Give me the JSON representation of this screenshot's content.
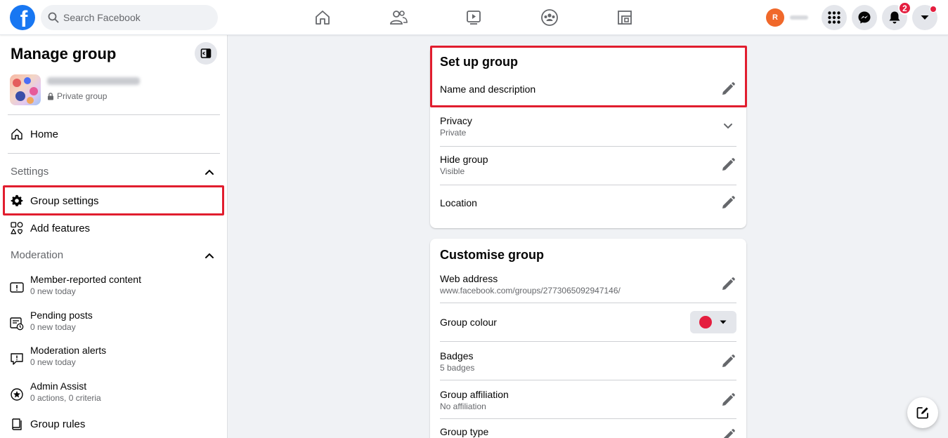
{
  "topbar": {
    "logo_letter": "f",
    "search_placeholder": "Search Facebook",
    "nav_icons": [
      "home-icon",
      "friends-icon",
      "watch-icon",
      "groups-icon",
      "gaming-icon"
    ],
    "avatar_initial": "R",
    "notification_count": "2",
    "right_icons": [
      "menu-grid-icon",
      "messenger-icon",
      "bell-icon",
      "account-caret-icon"
    ]
  },
  "sidebar": {
    "title": "Manage group",
    "group_privacy": "Private group",
    "home_label": "Home",
    "settings_section": "Settings",
    "group_settings_label": "Group settings",
    "add_features_label": "Add features",
    "moderation_section": "Moderation",
    "moderation_items": [
      {
        "title": "Member-reported content",
        "subtitle": "0 new today",
        "icon": "report-icon"
      },
      {
        "title": "Pending posts",
        "subtitle": "0 new today",
        "icon": "pending-posts-icon"
      },
      {
        "title": "Moderation alerts",
        "subtitle": "0 new today",
        "icon": "alert-bubble-icon"
      },
      {
        "title": "Admin Assist",
        "subtitle": "0 actions, 0 criteria",
        "icon": "admin-assist-icon"
      }
    ],
    "group_rules_label": "Group rules"
  },
  "setup": {
    "title": "Set up group",
    "name_desc_label": "Name and description",
    "privacy_label": "Privacy",
    "privacy_value": "Private",
    "hide_label": "Hide group",
    "hide_value": "Visible",
    "location_label": "Location"
  },
  "customise": {
    "title": "Customise group",
    "web_address_label": "Web address",
    "web_address_value": "www.facebook.com/groups/2773065092947146/",
    "colour_label": "Group colour",
    "colour_value": "#e41e3f",
    "badges_label": "Badges",
    "badges_value": "5 badges",
    "affiliation_label": "Group affiliation",
    "affiliation_value": "No affiliation",
    "type_label": "Group type"
  },
  "colors": {
    "brand": "#1877f2",
    "highlight": "#e11d2e",
    "notification": "#e41e3f"
  }
}
